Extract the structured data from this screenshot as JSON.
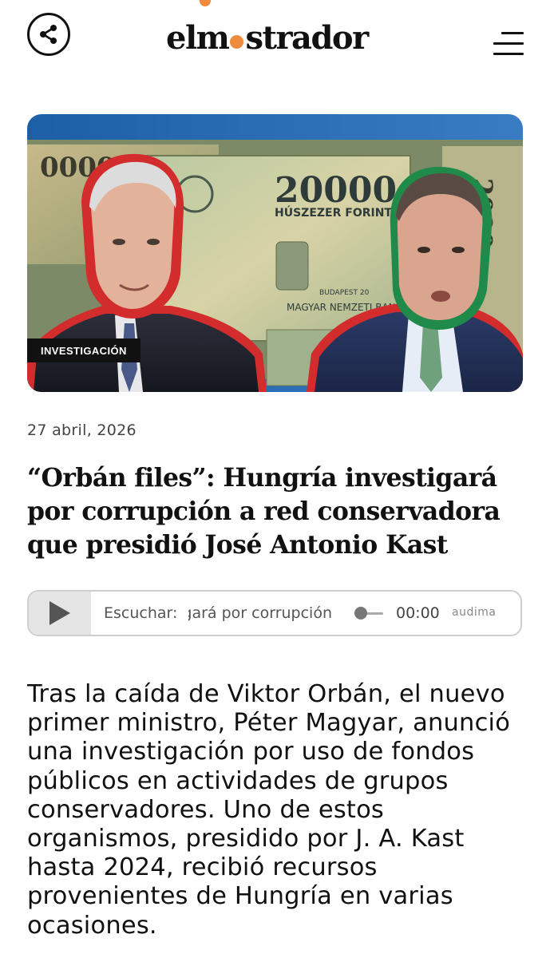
{
  "header": {
    "logo_prefix": "elm",
    "logo_suffix": "strador",
    "accent_color": "#f08a3c",
    "share_icon": "share-icon",
    "menu_icon": "hamburger-menu-icon"
  },
  "hero": {
    "banknote_value": "20000",
    "banknote_name": "HÚSZEZER FORINT",
    "banknote_issuer": "MAGYAR NEMZETI BANK",
    "banknote_city": "BUDAPEST 20",
    "category_badge": "INVESTIGACIÓN"
  },
  "article": {
    "date": "27 abril, 2026",
    "title": "“Orbán files”: Hungría investigará por corrupción a red conservadora que presidió José Antonio Kast",
    "body": "Tras la caída de Viktor Orbán, el nuevo primer ministro, Péter Magyar, anunció una investigación por uso de fondos públicos en actividades de grupos conservadores. Uno de estos organismos, presidido por J. A. Kast hasta 2024, recibió recursos provenientes de Hungría en varias ocasiones."
  },
  "player": {
    "listen_label": "Escuchar:",
    "scrolling_text": "“Orbán files”: Hungría investigará por corrupción",
    "time": "00:00",
    "brand": "audima",
    "play_icon": "play-icon"
  }
}
